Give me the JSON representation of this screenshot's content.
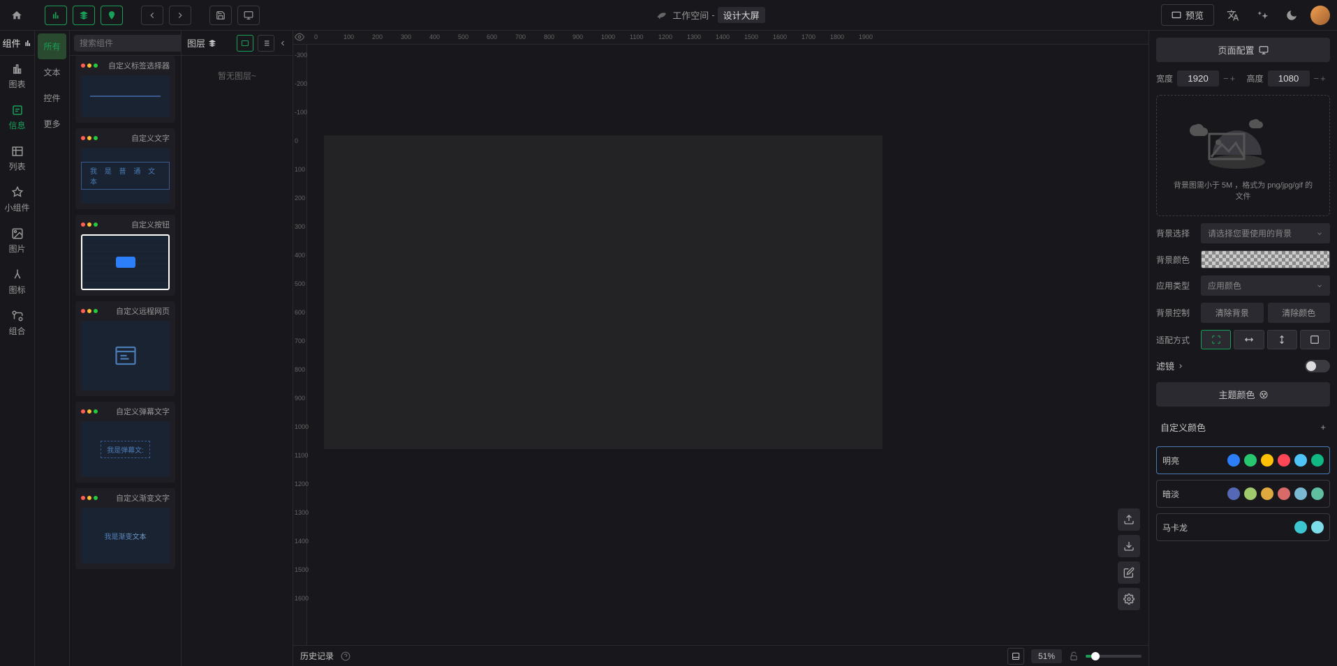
{
  "topbar": {
    "breadcrumb_root": "工作空间",
    "breadcrumb_sep": "-",
    "breadcrumb_current": "设计大屏",
    "preview": "预览"
  },
  "sidebar": {
    "title": "组件",
    "items": [
      {
        "label": "图表"
      },
      {
        "label": "信息"
      },
      {
        "label": "列表"
      },
      {
        "label": "小组件"
      },
      {
        "label": "图片"
      },
      {
        "label": "图标"
      },
      {
        "label": "组合"
      }
    ]
  },
  "categories": [
    "所有",
    "文本",
    "控件",
    "更多"
  ],
  "search_placeholder": "搜索组件",
  "components": [
    {
      "title": "自定义标签选择器",
      "preview_text": ""
    },
    {
      "title": "自定义文字",
      "preview_text": "我 是 普 通 文 本"
    },
    {
      "title": "自定义按钮",
      "preview_text": "",
      "selected": true
    },
    {
      "title": "自定义远程网页",
      "preview_text": ""
    },
    {
      "title": "自定义弹幕文字",
      "preview_text": "我是弹幕文:"
    },
    {
      "title": "自定义渐变文字",
      "preview_text": "我是渐变文本"
    }
  ],
  "layers": {
    "title": "图层",
    "empty": "暂无图层~"
  },
  "canvas": {
    "history": "历史记录",
    "zoom": "51%"
  },
  "right": {
    "header": "页面配置",
    "width_label": "宽度",
    "width_value": "1920",
    "height_label": "高度",
    "height_value": "1080",
    "bg_hint": "背景图需小于 5M ，格式为 png/jpg/gif 的文件",
    "bg_select_label": "背景选择",
    "bg_select_placeholder": "请选择您要使用的背景",
    "bg_color_label": "背景颜色",
    "app_type_label": "应用类型",
    "app_type_value": "应用颜色",
    "bg_ctrl_label": "背景控制",
    "clear_bg": "清除背景",
    "clear_color": "清除颜色",
    "fit_label": "适配方式",
    "filter_label": "滤镜",
    "theme_header": "主题颜色",
    "custom_color": "自定义颜色",
    "palettes": [
      {
        "name": "明亮",
        "colors": [
          "#2d7ff9",
          "#28c76f",
          "#ffc107",
          "#ff4757",
          "#4fc3f7",
          "#10b981"
        ],
        "active": true
      },
      {
        "name": "暗淡",
        "colors": [
          "#5468b5",
          "#a0ca6c",
          "#dfa93f",
          "#d96a6a",
          "#7bb8d1",
          "#5fbf9f"
        ]
      },
      {
        "name": "马卡龙",
        "colors": [
          "#3dc5d0",
          "#7bdde8"
        ]
      }
    ]
  }
}
